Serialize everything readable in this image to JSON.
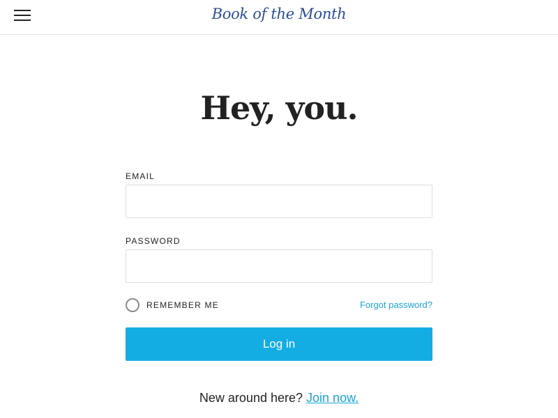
{
  "header": {
    "logo_text": "Book of the Month",
    "menu_icon": "hamburger-menu-icon"
  },
  "main": {
    "headline": "Hey, you.",
    "email": {
      "label": "EMAIL",
      "value": "",
      "placeholder": ""
    },
    "password": {
      "label": "PASSWORD",
      "value": "",
      "placeholder": ""
    },
    "remember_me": {
      "label": "REMEMBER ME",
      "checked": false
    },
    "forgot_password": "Forgot password?",
    "login_button": "Log in",
    "signup_prompt": "New around here?",
    "signup_link": "Join now."
  },
  "colors": {
    "logo": "#2a4d97",
    "accent": "#14ade3",
    "link": "#1aa3d6",
    "text": "#222222"
  }
}
